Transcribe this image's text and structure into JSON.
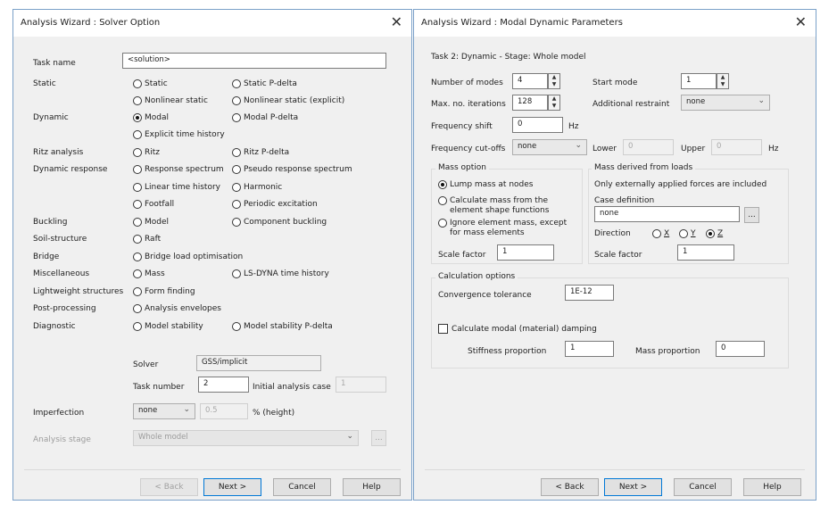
{
  "solver_dialog": {
    "title": "Analysis Wizard : Solver Option",
    "close": "✕",
    "task_name_label": "Task name",
    "task_name_value": "<solution>",
    "categories": {
      "static": "Static",
      "dynamic": "Dynamic",
      "ritz": "Ritz analysis",
      "dynamic_response": "Dynamic response",
      "buckling": "Buckling",
      "soil_structure": "Soil-structure",
      "bridge": "Bridge",
      "misc": "Miscellaneous",
      "lightweight": "Lightweight structures",
      "post": "Post-processing",
      "diagnostic": "Diagnostic"
    },
    "options": {
      "static": "Static",
      "static_pdelta": "Static P-delta",
      "nonlinear_static": "Nonlinear static",
      "nonlinear_static_explicit": "Nonlinear static (explicit)",
      "modal": "Modal",
      "modal_pdelta": "Modal P-delta",
      "explicit_time_history": "Explicit time history",
      "ritz": "Ritz",
      "ritz_pdelta": "Ritz P-delta",
      "response_spectrum": "Response spectrum",
      "pseudo_response_spectrum": "Pseudo response spectrum",
      "linear_time_history": "Linear time history",
      "harmonic": "Harmonic",
      "footfall": "Footfall",
      "periodic_excitation": "Periodic excitation",
      "model_buckling": "Model",
      "component_buckling": "Component buckling",
      "raft": "Raft",
      "bridge_load_optimisation": "Bridge load optimisation",
      "mass": "Mass",
      "lsdyna": "LS-DYNA time history",
      "form_finding": "Form finding",
      "analysis_envelopes": "Analysis envelopes",
      "model_stability": "Model stability",
      "model_stability_pdelta": "Model stability P-delta"
    },
    "selected_option": "Modal",
    "solver_label": "Solver",
    "solver_value": "GSS/implicit",
    "task_number_label": "Task number",
    "task_number_value": "2",
    "initial_case_label": "Initial analysis case",
    "initial_case_value": "1",
    "imperfection_label": "Imperfection",
    "imperfection_value": "none",
    "imperfection_amount": "0.5",
    "height_label": "% (height)",
    "analysis_stage_label": "Analysis stage",
    "analysis_stage_value": "Whole model",
    "ellipsis": "...",
    "buttons": {
      "back": "< Back",
      "next": "Next >",
      "cancel": "Cancel",
      "help": "Help"
    }
  },
  "modal_dialog": {
    "title": "Analysis Wizard : Modal Dynamic Parameters",
    "close": "✕",
    "task_info": "Task 2: Dynamic  -  Stage: Whole model",
    "num_modes_label": "Number of modes",
    "num_modes_value": "4",
    "start_mode_label": "Start mode",
    "start_mode_value": "1",
    "max_iter_label": "Max. no. iterations",
    "max_iter_value": "128",
    "additional_restraint_label": "Additional restraint",
    "additional_restraint_value": "none",
    "freq_shift_label": "Frequency shift",
    "freq_shift_value": "0",
    "hz": "Hz",
    "freq_cutoffs_label": "Frequency cut-offs",
    "freq_cutoffs_value": "none",
    "lower_label": "Lower",
    "lower_value": "0",
    "upper_label": "Upper",
    "upper_value": "0",
    "mass_option": {
      "title": "Mass option",
      "lump": "Lump mass at nodes",
      "calculate_l1": "Calculate mass from the",
      "calculate_l2": "element shape functions",
      "ignore_l1": "Ignore element mass, except",
      "ignore_l2": "for mass elements",
      "selected": "Lump mass at nodes",
      "scale_factor_label": "Scale factor",
      "scale_factor_value": "1"
    },
    "mass_from_loads": {
      "title": "Mass derived from loads",
      "note": "Only externally applied forces are included",
      "case_definition_label": "Case definition",
      "case_definition_value": "none",
      "direction_label": "Direction",
      "dir_x": "X",
      "dir_y": "Y",
      "dir_z": "Z",
      "selected_direction": "Z",
      "scale_factor_label": "Scale factor",
      "scale_factor_value": "1"
    },
    "calculation_options": {
      "title": "Calculation options",
      "convergence_label": "Convergence tolerance",
      "convergence_value": "1E-12",
      "damping_label": "Calculate modal (material) damping",
      "damping_checked": false,
      "stiffness_label": "Stiffness proportion",
      "stiffness_value": "1",
      "mass_prop_label": "Mass proportion",
      "mass_prop_value": "0"
    },
    "ellipsis": "...",
    "buttons": {
      "back": "< Back",
      "next": "Next >",
      "cancel": "Cancel",
      "help": "Help"
    }
  },
  "colors": {
    "dialog_bg": "#f0f0f0",
    "default_button_border": "#0078d7",
    "title_bar": "#ffffff"
  }
}
